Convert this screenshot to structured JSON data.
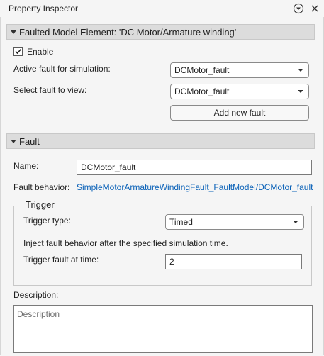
{
  "panel": {
    "title": "Property Inspector"
  },
  "faulted_section": {
    "header": "Faulted Model Element: 'DC Motor/Armature winding'",
    "enable_label": "Enable",
    "enable_checked": true,
    "active_fault_label": "Active fault for simulation:",
    "active_fault_value": "DCMotor_fault",
    "select_fault_label": "Select fault to view:",
    "select_fault_value": "DCMotor_fault",
    "add_fault_button": "Add new fault"
  },
  "fault_section": {
    "header": "Fault",
    "name_label": "Name:",
    "name_value": "DCMotor_fault",
    "behavior_label": "Fault behavior:",
    "behavior_link": "SimpleMotorArmatureWindingFault_FaultModel/DCMotor_fault",
    "trigger": {
      "legend": "Trigger",
      "type_label": "Trigger type:",
      "type_value": "Timed",
      "description": "Inject fault behavior after the specified simulation time.",
      "time_label": "Trigger fault at time:",
      "time_value": "2"
    },
    "description_label": "Description:",
    "description_placeholder": "Description"
  },
  "colors": {
    "link": "#0b62b8",
    "section_header_bg": "#dcdcdc",
    "panel_bg": "#f5f5f5"
  },
  "icons": {
    "options": "chevron-circle-down-icon",
    "close": "close-icon",
    "section_toggle": "triangle-down-icon"
  }
}
